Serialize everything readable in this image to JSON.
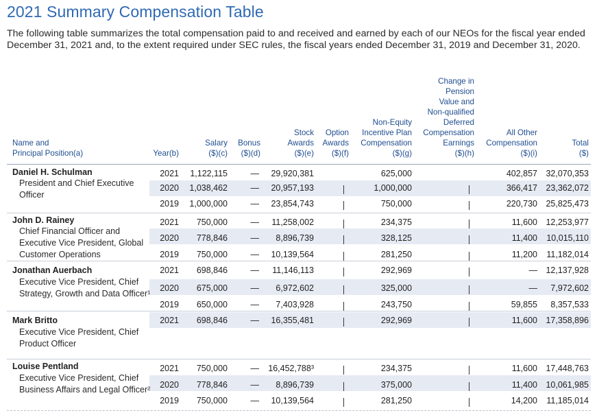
{
  "title": "2021 Summary Compensation Table",
  "intro": "The following table summarizes the total compensation paid to and received and earned by each of our NEOs for the fiscal year ended December 31, 2021 and, to the extent required under SEC rules, the fiscal years ended December 31, 2019 and December 31, 2020.",
  "headers": {
    "name": [
      "Name and",
      "Principal Position(a)"
    ],
    "year": [
      "Year(b)"
    ],
    "salary": [
      "Salary",
      "($)(c)"
    ],
    "bonus": [
      "Bonus",
      "($)(d)"
    ],
    "stock": [
      "Stock",
      "Awards",
      "($)(e)"
    ],
    "option": [
      "Option",
      "Awards",
      "($)(f)"
    ],
    "nonequity": [
      "Non-Equity",
      "Incentive Plan",
      "Compensation",
      "($)(g)"
    ],
    "pension": [
      "Change in",
      "Pension",
      "Value and",
      "Non-qualified",
      "Deferred",
      "Compensation",
      "Earnings",
      "($)(h)"
    ],
    "other": [
      "All Other",
      "Compensation",
      "($)(i)"
    ],
    "total": [
      "Total",
      "($)"
    ]
  },
  "executives": [
    {
      "name": "Daniel H. Schulman",
      "position": "President and Chief Executive Officer",
      "rows": [
        {
          "year": "2021",
          "salary": "1,122,115",
          "bonus": "—",
          "stock": "29,920,381",
          "option": "",
          "nonequity": "625,000",
          "pension": "",
          "other": "402,857",
          "total": "32,070,353"
        },
        {
          "year": "2020",
          "salary": "1,038,462",
          "bonus": "—",
          "stock": "20,957,193",
          "option": "—",
          "nonequity": "1,000,000",
          "pension": "—",
          "other": "366,417",
          "total": "23,362,072"
        },
        {
          "year": "2019",
          "salary": "1,000,000",
          "bonus": "—",
          "stock": "23,854,743",
          "option": "—",
          "nonequity": "750,000",
          "pension": "—",
          "other": "220,730",
          "total": "25,825,473"
        }
      ]
    },
    {
      "name": "John D. Rainey",
      "position": "Chief Financial Officer and Executive Vice President, Global Customer Operations",
      "rows": [
        {
          "year": "2021",
          "salary": "750,000",
          "bonus": "—",
          "stock": "11,258,002",
          "option": "—",
          "nonequity": "234,375",
          "pension": "—",
          "other": "11,600",
          "total": "12,253,977"
        },
        {
          "year": "2020",
          "salary": "778,846",
          "bonus": "—",
          "stock": "8,896,739",
          "option": "—",
          "nonequity": "328,125",
          "pension": "—",
          "other": "11,400",
          "total": "10,015,110"
        },
        {
          "year": "2019",
          "salary": "750,000",
          "bonus": "—",
          "stock": "10,139,564",
          "option": "—",
          "nonequity": "281,250",
          "pension": "—",
          "other": "11,200",
          "total": "11,182,014"
        }
      ]
    },
    {
      "name": "Jonathan Auerbach",
      "position": "Executive Vice President, Chief Strategy, Growth and Data Officer¹",
      "rows": [
        {
          "year": "2021",
          "salary": "698,846",
          "bonus": "—",
          "stock": "11,146,113",
          "option": "—",
          "nonequity": "292,969",
          "pension": "—",
          "other": "—",
          "total": "12,137,928"
        },
        {
          "year": "2020",
          "salary": "675,000",
          "bonus": "—",
          "stock": "6,972,602",
          "option": "—",
          "nonequity": "325,000",
          "pension": "—",
          "other": "—",
          "total": "7,972,602"
        },
        {
          "year": "2019",
          "salary": "650,000",
          "bonus": "—",
          "stock": "7,403,928",
          "option": "—",
          "nonequity": "243,750",
          "pension": "—",
          "other": "59,855",
          "total": "8,357,533"
        }
      ]
    },
    {
      "name": "Mark Britto",
      "position": "Executive Vice President, Chief Product Officer",
      "rows": [
        {
          "year": "2021",
          "salary": "698,846",
          "bonus": "—",
          "stock": "16,355,481",
          "option": "—",
          "nonequity": "292,969",
          "pension": "—",
          "other": "11,600",
          "total": "17,358,896"
        }
      ]
    },
    {
      "name": "Louise Pentland",
      "position": "Executive Vice President, Chief Business Affairs and Legal Officer²",
      "rows": [
        {
          "year": "2021",
          "salary": "750,000",
          "bonus": "—",
          "stock": "16,452,788³",
          "option": "—",
          "nonequity": "234,375",
          "pension": "—",
          "other": "11,600",
          "total": "17,448,763"
        },
        {
          "year": "2020",
          "salary": "778,846",
          "bonus": "—",
          "stock": "8,896,739",
          "option": "—",
          "nonequity": "375,000",
          "pension": "—",
          "other": "11,400",
          "total": "10,061,985"
        },
        {
          "year": "2019",
          "salary": "750,000",
          "bonus": "—",
          "stock": "10,139,564",
          "option": "—",
          "nonequity": "281,250",
          "pension": "—",
          "other": "14,200",
          "total": "11,185,014"
        }
      ]
    }
  ]
}
